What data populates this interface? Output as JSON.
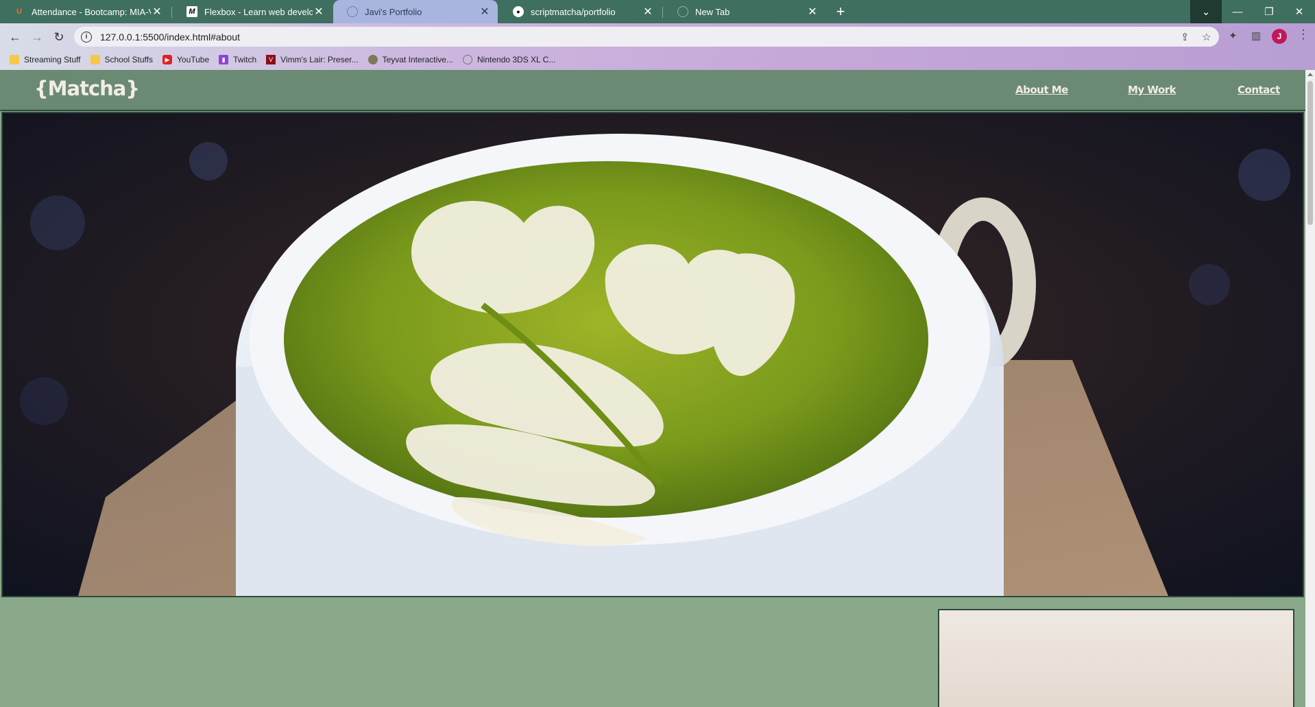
{
  "browser": {
    "tabs": [
      {
        "title": "Attendance - Bootcamp: MIA-VIR",
        "icon": "bootcamp-icon"
      },
      {
        "title": "Flexbox - Learn web development",
        "icon": "mdn-icon"
      },
      {
        "title": "Javi's Portfolio",
        "icon": "globe-icon",
        "active": true
      },
      {
        "title": "scriptmatcha/portfolio",
        "icon": "github-icon"
      },
      {
        "title": "New Tab",
        "icon": "chrome-icon"
      }
    ],
    "new_tab_glyph": "+",
    "url": "127.0.0.1:5500/index.html#about",
    "profile_initial": "J",
    "bookmarks": [
      {
        "label": "Streaming Stuff",
        "icon": "folder-icon"
      },
      {
        "label": "School Stuffs",
        "icon": "folder-icon"
      },
      {
        "label": "YouTube",
        "icon": "youtube-icon"
      },
      {
        "label": "Twitch",
        "icon": "twitch-icon"
      },
      {
        "label": "Vimm's Lair: Preser...",
        "icon": "vimms-lair-icon"
      },
      {
        "label": "Teyvat Interactive...",
        "icon": "teyvat-icon"
      },
      {
        "label": "Nintendo 3DS XL C...",
        "icon": "globe-icon"
      }
    ]
  },
  "site": {
    "logo": "{Matcha}",
    "nav": [
      "About Me",
      "My Work",
      "Contact"
    ],
    "hero_image": "matcha-latte-art-image",
    "colors": {
      "header": "#6b8a73",
      "background": "#8aa88a",
      "border": "#2e4a3a",
      "text": "#f1ede6"
    }
  }
}
